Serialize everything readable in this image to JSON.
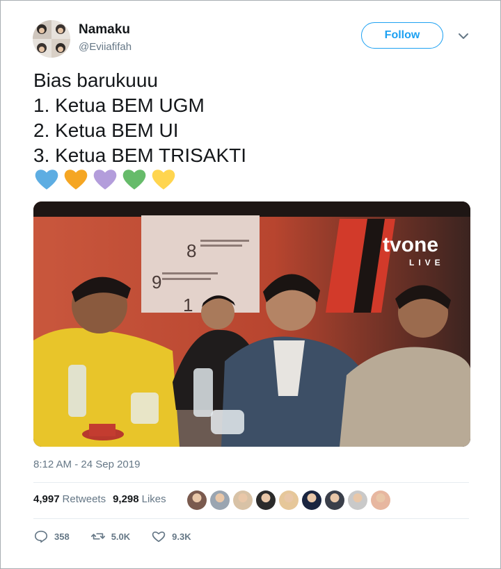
{
  "user": {
    "name": "Namaku",
    "handle": "@Eviiafifah",
    "follow_label": "Follow"
  },
  "tweet": {
    "text_lines": [
      "Bias barukuuu",
      "1. Ketua BEM UGM",
      "2. Ketua BEM UI",
      "3. Ketua BEM TRISAKTI"
    ],
    "emoji_hearts": [
      {
        "icon": "blue-heart-icon",
        "color": "#5dade2"
      },
      {
        "icon": "orange-heart-icon",
        "color": "#f5a623"
      },
      {
        "icon": "purple-heart-icon",
        "color": "#b39ddb"
      },
      {
        "icon": "green-heart-icon",
        "color": "#66bb6a"
      },
      {
        "icon": "yellow-heart-icon",
        "color": "#ffd54f"
      }
    ],
    "media": {
      "logo": "tvone",
      "live": "LIVE",
      "board_numbers": [
        "8",
        "9",
        "1"
      ]
    },
    "timestamp": "8:12 AM - 24 Sep 2019"
  },
  "stats": {
    "retweets_count": "4,997",
    "retweets_label": "Retweets",
    "likes_count": "9,298",
    "likes_label": "Likes"
  },
  "likers": [
    {
      "color": "#7a5a4e"
    },
    {
      "color": "#9aa5b1"
    },
    {
      "color": "#d8c2a6"
    },
    {
      "color": "#2b2b2b"
    },
    {
      "color": "#e6c79a"
    },
    {
      "color": "#1a2540"
    },
    {
      "color": "#3a3f4a"
    },
    {
      "color": "#c9c9c9"
    },
    {
      "color": "#e7b7a0"
    }
  ],
  "actions": {
    "replies": "358",
    "retweets": "5.0K",
    "likes": "9.3K"
  }
}
